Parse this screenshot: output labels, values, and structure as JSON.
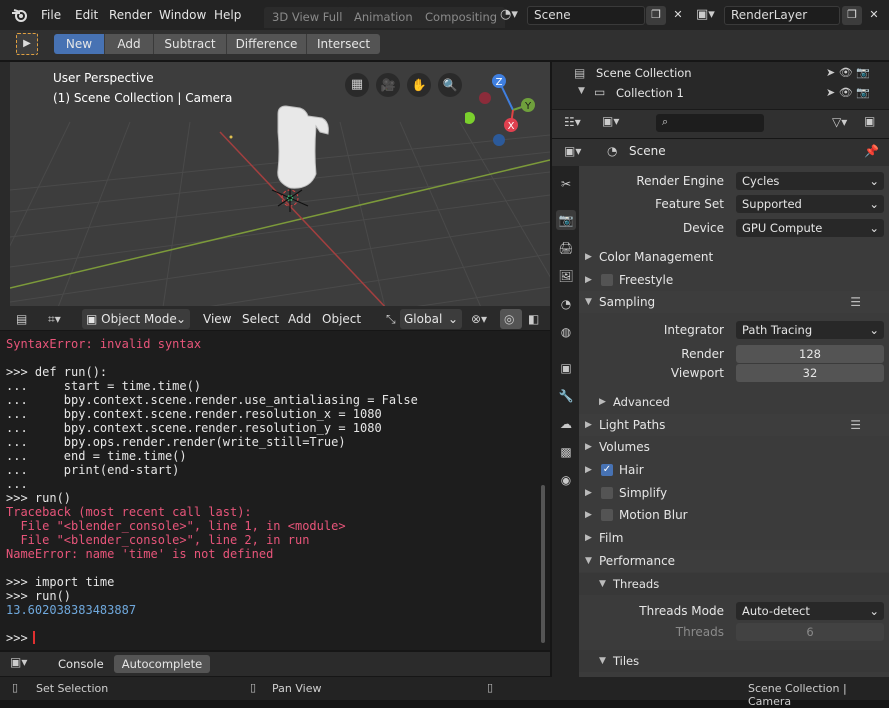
{
  "topbar": {
    "menus": [
      "File",
      "Edit",
      "Render",
      "Window",
      "Help"
    ],
    "workspace_tabs": [
      "3D View Full",
      "Animation",
      "Compositing"
    ],
    "scene_name": "Scene",
    "view_layer": "RenderLayer"
  },
  "tool_header": {
    "modes": [
      "New",
      "Add",
      "Subtract",
      "Difference",
      "Intersect"
    ],
    "active_mode": "New"
  },
  "viewport": {
    "perspective": "User Perspective",
    "collection": "(1) Scene Collection | Camera",
    "gizmo": {
      "x": "X",
      "y": "Y",
      "z": "Z"
    },
    "header": {
      "mode": "Object Mode",
      "menus": [
        "View",
        "Select",
        "Add",
        "Object"
      ],
      "orientation": "Global"
    }
  },
  "console": {
    "lines": [
      {
        "text": "SyntaxError: invalid syntax",
        "color": "#e8557a"
      },
      {
        "text": "",
        "color": "#e6e6e6"
      },
      {
        "text": ">>> def run():",
        "color": "#e6e6e6"
      },
      {
        "text": "...     start = time.time()",
        "color": "#e6e6e6"
      },
      {
        "text": "...     bpy.context.scene.render.use_antialiasing = False",
        "color": "#e6e6e6"
      },
      {
        "text": "...     bpy.context.scene.render.resolution_x = 1080",
        "color": "#e6e6e6"
      },
      {
        "text": "...     bpy.context.scene.render.resolution_y = 1080",
        "color": "#e6e6e6"
      },
      {
        "text": "...     bpy.ops.render.render(write_still=True)",
        "color": "#e6e6e6"
      },
      {
        "text": "...     end = time.time()",
        "color": "#e6e6e6"
      },
      {
        "text": "...     print(end-start)",
        "color": "#e6e6e6"
      },
      {
        "text": "...",
        "color": "#e6e6e6"
      },
      {
        "text": ">>> run()",
        "color": "#e6e6e6"
      },
      {
        "text": "Traceback (most recent call last):",
        "color": "#e8557a"
      },
      {
        "text": "  File \"<blender_console>\", line 1, in <module>",
        "color": "#e8557a"
      },
      {
        "text": "  File \"<blender_console>\", line 2, in run",
        "color": "#e8557a"
      },
      {
        "text": "NameError: name 'time' is not defined",
        "color": "#e8557a"
      },
      {
        "text": "",
        "color": "#e6e6e6"
      },
      {
        "text": ">>> import time",
        "color": "#e6e6e6"
      },
      {
        "text": ">>> run()",
        "color": "#e6e6e6"
      },
      {
        "text": "13.602038383483887",
        "color": "#6fa8dc"
      },
      {
        "text": "",
        "color": "#e6e6e6"
      },
      {
        "text": ">>> ",
        "color": "#e6e6e6"
      }
    ],
    "tabs": [
      "Console",
      "Autocomplete"
    ]
  },
  "outliner": {
    "root": "Scene Collection",
    "child": "Collection 1"
  },
  "properties": {
    "scene_label": "Scene",
    "render_engine_label": "Render Engine",
    "render_engine": "Cycles",
    "feature_set_label": "Feature Set",
    "feature_set": "Supported",
    "device_label": "Device",
    "device": "GPU Compute",
    "panels": {
      "color_management": "Color Management",
      "freestyle": "Freestyle",
      "sampling": "Sampling",
      "advanced": "Advanced",
      "light_paths": "Light Paths",
      "volumes": "Volumes",
      "hair": "Hair",
      "simplify": "Simplify",
      "motion_blur": "Motion Blur",
      "film": "Film",
      "performance": "Performance",
      "threads": "Threads",
      "tiles": "Tiles"
    },
    "integrator_label": "Integrator",
    "integrator": "Path Tracing",
    "render_label": "Render",
    "render_samples": "128",
    "viewport_label": "Viewport",
    "viewport_samples": "32",
    "threads_mode_label": "Threads Mode",
    "threads_mode": "Auto-detect",
    "threads_label": "Threads",
    "threads_count": "6",
    "hair_checked": true
  },
  "statusbar": {
    "left": "Set Selection",
    "middle": "Pan View",
    "right": "Scene Collection | Camera"
  },
  "colors": {
    "accent": "#4772b3",
    "error": "#e8557a",
    "output": "#6fa8dc"
  }
}
